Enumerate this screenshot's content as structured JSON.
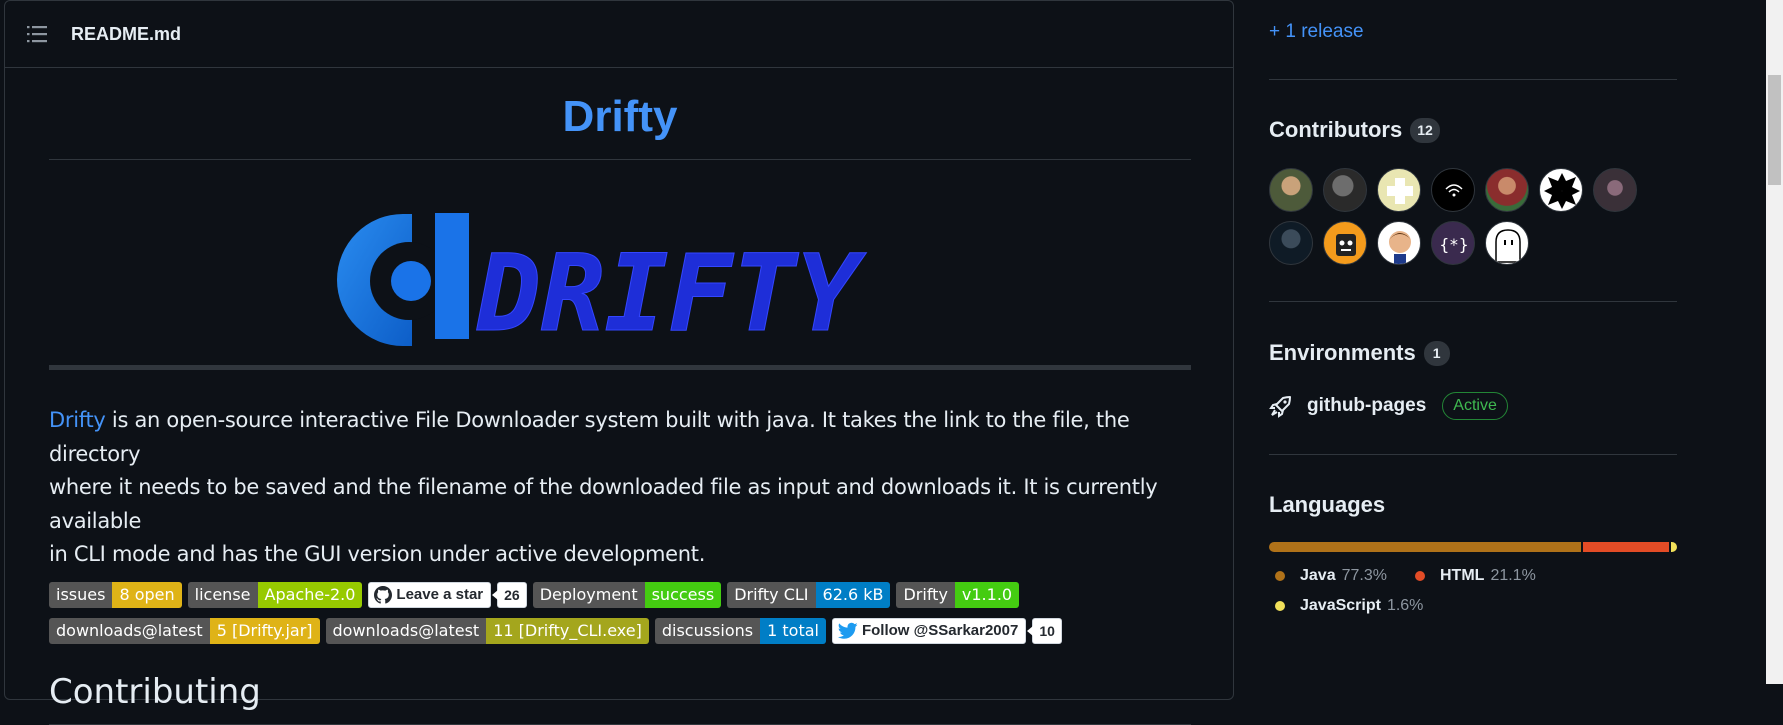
{
  "readme": {
    "title": "README.md",
    "heading": "Drifty",
    "logo_text": "DRIFTY",
    "description_link": "Drifty",
    "description_lines": [
      " is an open-source interactive File Downloader system built with java. It takes the link to the file, the directory",
      "where it needs to be saved and the filename of the downloaded file as input and downloads it. It is currently available",
      "in CLI mode and has the GUI version under active development."
    ],
    "badges_row1": [
      {
        "label": "issues",
        "value": "8 open",
        "color": "#dfb317"
      },
      {
        "label": "license",
        "value": "Apache-2.0",
        "color": "#97ca00"
      }
    ],
    "star_button": {
      "label": "Leave a star",
      "count": "26"
    },
    "badges_row1b": [
      {
        "label": "Deployment",
        "value": "success",
        "color": "#4c1"
      },
      {
        "label": "Drifty CLI",
        "value": "62.6 kB",
        "color": "#007ec6"
      },
      {
        "label": "Drifty",
        "value": "v1.1.0",
        "color": "#4c1"
      }
    ],
    "badges_row2": [
      {
        "label": "downloads@latest",
        "value": "5 [Drifty.jar]",
        "color": "#dfb317"
      },
      {
        "label": "downloads@latest",
        "value": "11 [Drifty_CLI.exe]",
        "color": "#a4a61d"
      },
      {
        "label": "discussions",
        "value": "1 total",
        "color": "#007ec6"
      }
    ],
    "follow_button": {
      "label": "Follow @SSarkar2007",
      "count": "10"
    },
    "section_heading": "Contributing"
  },
  "sidebar": {
    "release_link": "+ 1 release",
    "contributors": {
      "title": "Contributors",
      "count": "12"
    },
    "environments": {
      "title": "Environments",
      "count": "1",
      "env_name": "github-pages",
      "status": "Active"
    },
    "languages": {
      "title": "Languages",
      "items": [
        {
          "name": "Java",
          "percent": "77.3%",
          "value": 77.3,
          "color": "#b07219"
        },
        {
          "name": "HTML",
          "percent": "21.1%",
          "value": 21.1,
          "color": "#e34c26"
        },
        {
          "name": "JavaScript",
          "percent": "1.6%",
          "value": 1.6,
          "color": "#f1e05a"
        }
      ]
    }
  }
}
